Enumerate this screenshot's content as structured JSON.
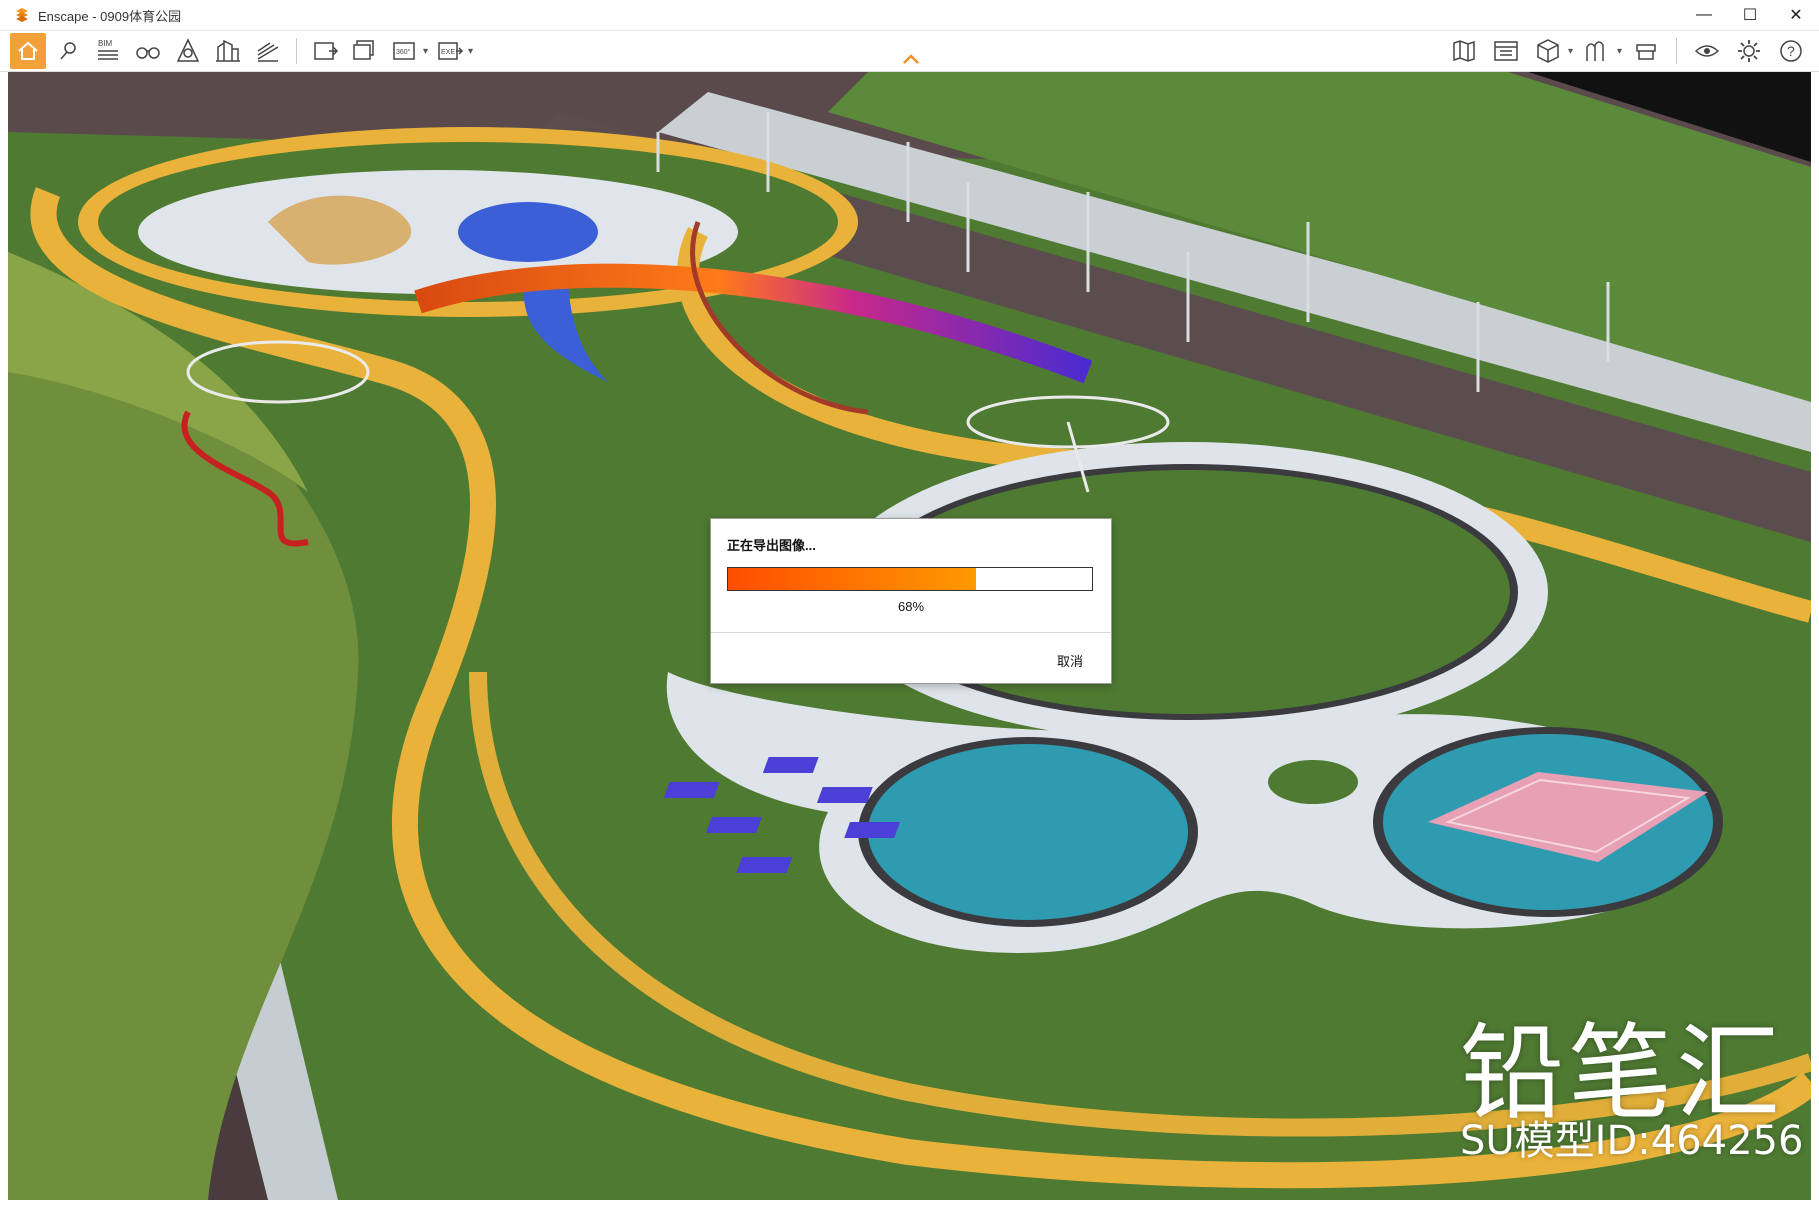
{
  "window": {
    "title": "Enscape - 0909体育公园",
    "controls": {
      "minimize": "—",
      "maximize": "☐",
      "close": "✕"
    }
  },
  "toolbar": {
    "left_icons": [
      "home-icon",
      "location-pin-icon",
      "bim-icon",
      "binoculars-icon",
      "sun-icon",
      "buildings-icon",
      "section-cut-icon",
      "render-screenshot-icon",
      "batch-render-icon",
      "panorama-360-icon",
      "export-exe-icon"
    ],
    "bim_label": "BIM",
    "pano_label": "360°",
    "exe_label": "EXE",
    "right_icons": [
      "map-icon",
      "asset-library-icon",
      "cube-icon",
      "visual-settings-icon",
      "capture-icon",
      "view-eye-icon",
      "settings-gear-icon",
      "help-icon"
    ]
  },
  "dialog": {
    "title": "正在导出图像...",
    "progress": 0.68,
    "percent_label": "68%",
    "cancel_label": "取消",
    "fill_start": "#ff4d00",
    "fill_end": "#ff9a00"
  },
  "watermark": {
    "brand": "铅笔汇",
    "id_text": "SU模型ID:464256"
  },
  "colors": {
    "accent_home": "#f2a03a",
    "grass": "#4f7a32",
    "track": "#e9b23a",
    "road": "#4a3c3e",
    "pool": "#2f9bb0",
    "court": "#e7a0b4"
  }
}
